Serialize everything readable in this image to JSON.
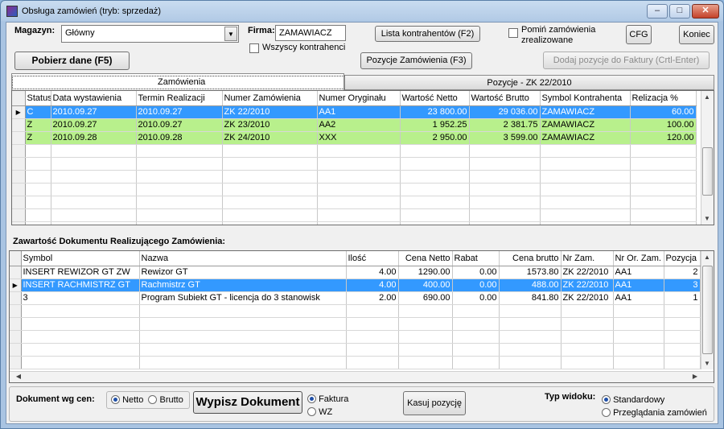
{
  "window": {
    "title": "Obsługa zamówień (tryb: sprzedaż)"
  },
  "form": {
    "magazyn_label": "Magazyn:",
    "magazyn_value": "Główny",
    "firma_label": "Firma:",
    "firma_value": "ZAMAWIACZ",
    "lista_btn": "Lista kontrahentów (F2)",
    "wszyscy_label": "Wszyscy kontrahenci",
    "pomin_label_1": "Pomiń zamówienia",
    "pomin_label_2": "zrealizowane",
    "cfg_btn": "CFG",
    "koniec_btn": "Koniec",
    "pobierz_btn": "Pobierz dane (F5)",
    "pozycje_btn": "Pozycje Zamówienia (F3)",
    "dodaj_btn": "Dodaj pozycje do Faktury (Crtl-Enter)"
  },
  "tabs": [
    "Zamówienia",
    "Pozycje - ZK 22/2010"
  ],
  "orders": {
    "columns": [
      "Status",
      "Data wystawienia",
      "Termin Realizacji",
      "Numer Zamówienia",
      "Numer Oryginału",
      "Wartość Netto",
      "Wartość Brutto",
      "Symbol Kontrahenta",
      "Relizacja %"
    ],
    "rows": [
      {
        "status": "C",
        "data": "2010.09.27",
        "termin": "2010.09.27",
        "numer": "ZK 22/2010",
        "oryg": "AA1",
        "netto": "23 800.00",
        "brutto": "29 036.00",
        "symbol": "ZAMAWIACZ",
        "real": "60.00"
      },
      {
        "status": "Z",
        "data": "2010.09.27",
        "termin": "2010.09.27",
        "numer": "ZK 23/2010",
        "oryg": "AA2",
        "netto": "1 952.25",
        "brutto": "2 381.75",
        "symbol": "ZAMAWIACZ",
        "real": "100.00"
      },
      {
        "status": "Z",
        "data": "2010.09.28",
        "termin": "2010.09.28",
        "numer": "ZK 24/2010",
        "oryg": "XXX",
        "netto": "2 950.00",
        "brutto": "3 599.00",
        "symbol": "ZAMAWIACZ",
        "real": "120.00"
      }
    ]
  },
  "section_label": "Zawartość Dokumentu Realizującego Zamówienia:",
  "items": {
    "columns": [
      "Symbol",
      "Nazwa",
      "Ilość",
      "Cena Netto",
      "Rabat",
      "Cena brutto",
      "Nr Zam.",
      "Nr Or. Zam.",
      "Pozycja"
    ],
    "rows": [
      {
        "symbol": "INSERT REWIZOR GT ZW",
        "nazwa": "Rewizor GT",
        "ilosc": "4.00",
        "netto": "1290.00",
        "rabat": "0.00",
        "brutto": "1573.80",
        "nrzam": "ZK 22/2010",
        "nror": "AA1",
        "poz": "2"
      },
      {
        "symbol": "INSERT RACHMISTRZ GT",
        "nazwa": "Rachmistrz GT",
        "ilosc": "4.00",
        "netto": "400.00",
        "rabat": "0.00",
        "brutto": "488.00",
        "nrzam": "ZK 22/2010",
        "nror": "AA1",
        "poz": "3"
      },
      {
        "symbol": "3",
        "nazwa": "Program Subiekt GT - licencja do 3 stanowisk",
        "ilosc": "2.00",
        "netto": "690.00",
        "rabat": "0.00",
        "brutto": "841.80",
        "nrzam": "ZK 22/2010",
        "nror": "AA1",
        "poz": "1"
      }
    ]
  },
  "bottom": {
    "dokument_label": "Dokument wg cen:",
    "netto": "Netto",
    "brutto": "Brutto",
    "wypisz_btn": "Wypisz Dokument",
    "faktura": "Faktura",
    "wz": "WZ",
    "kasuj_btn": "Kasuj pozycję",
    "typ_label": "Typ widoku:",
    "standardowy": "Standardowy",
    "przegladania": "Przeglądania zamówień"
  }
}
